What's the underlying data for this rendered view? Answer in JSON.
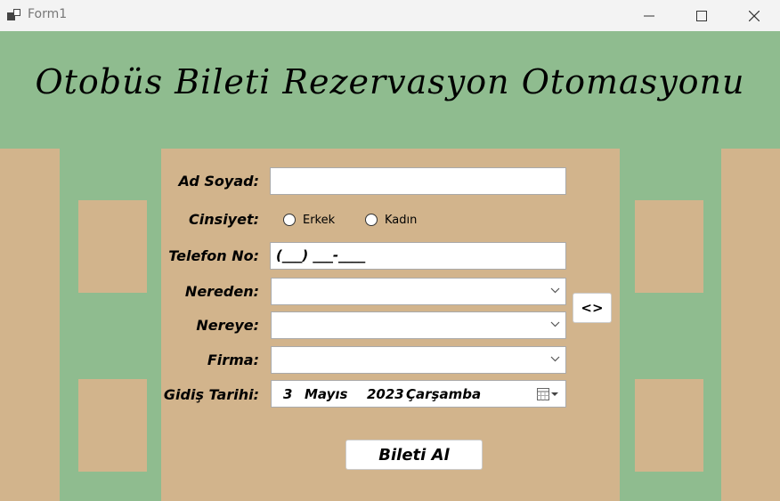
{
  "window": {
    "title": "Form1"
  },
  "heading": "Otobüs Bileti Rezervasyon Otomasyonu",
  "form": {
    "ad_soyad_label": "Ad Soyad:",
    "ad_soyad_value": "",
    "cinsiyet_label": "Cinsiyet:",
    "gender_options": [
      "Erkek",
      "Kadın"
    ],
    "telefon_label": "Telefon No:",
    "telefon_mask": "(___) ___-____",
    "nereden_label": "Nereden:",
    "nereden_value": "",
    "nereye_label": "Nereye:",
    "nereye_value": "",
    "firma_label": "Firma:",
    "firma_value": "",
    "gidis_label": "Gidiş Tarihi:",
    "date": {
      "day": "3",
      "month": "Mayıs",
      "year": "2023",
      "weekday": "Çarşamba"
    },
    "swap_button": "<>",
    "submit_button": "Bileti Al"
  },
  "colors": {
    "background": "#8fbc8f",
    "panel": "#d2b48c",
    "titlebar": "#f3f3f3"
  }
}
